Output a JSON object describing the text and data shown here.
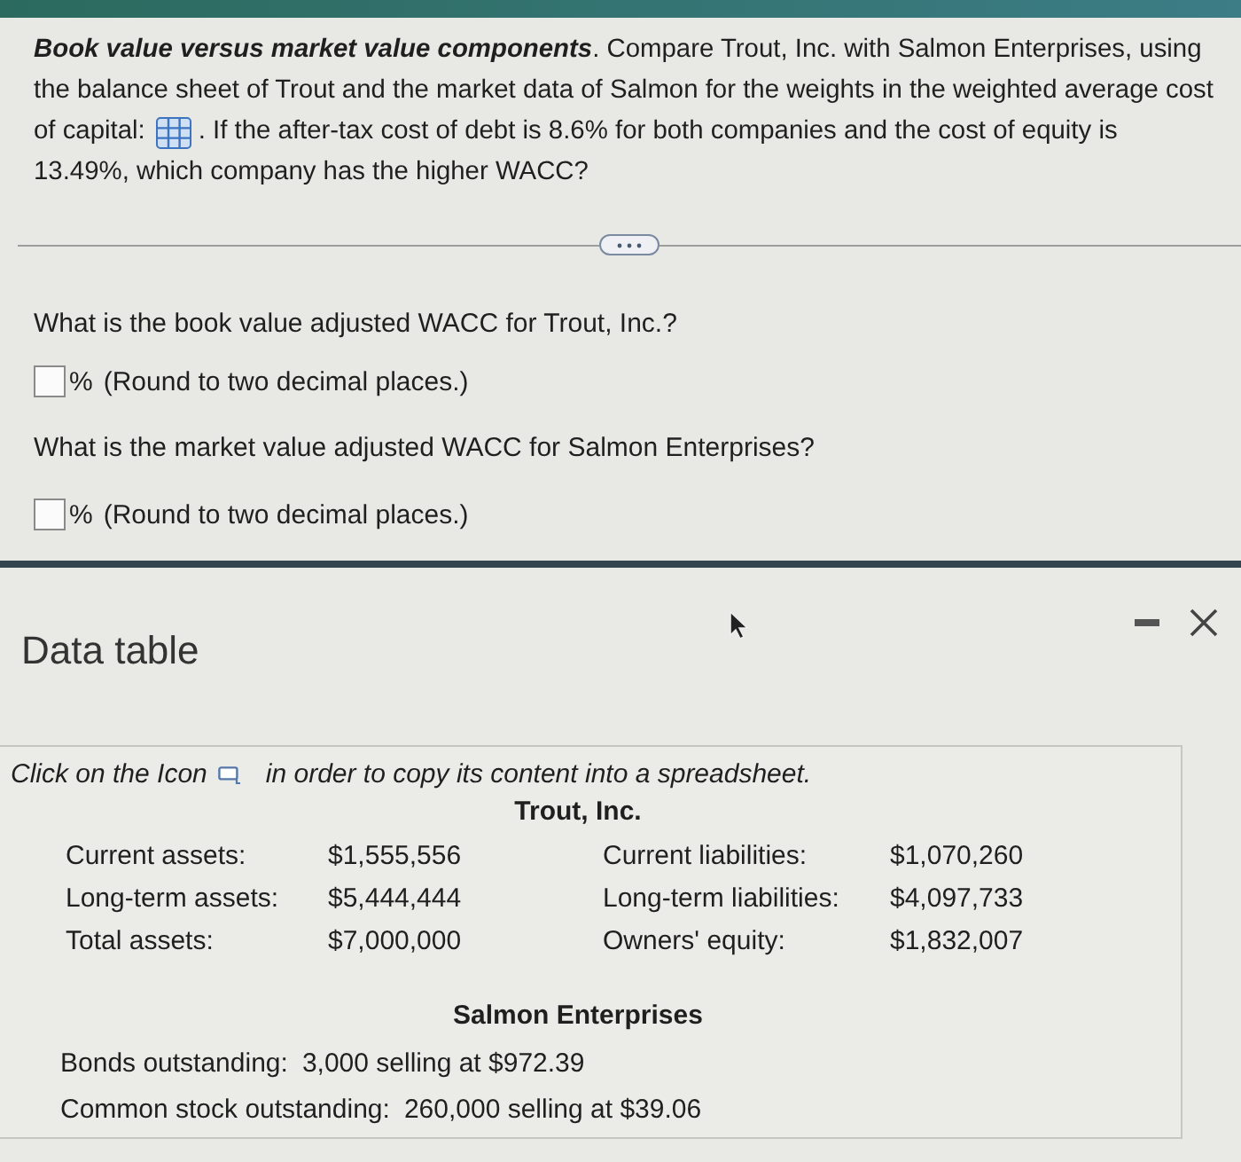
{
  "problem": {
    "title": "Book value versus market value components",
    "text_before_icon": ". Compare Trout, Inc. with Salmon Enterprises, using the balance sheet of Trout and the market data of Salmon for the weights in the weighted average cost",
    "text_beside_icon": "of capital:",
    "text_after_icon": ". If the after-tax cost of debt is 8.6% for both companies and the cost of equity is",
    "text_end": "13.49%, which company has the higher WACC?"
  },
  "questions": [
    {
      "prompt": "What is the book value adjusted WACC for Trout, Inc.?",
      "unit": "%",
      "hint": "(Round to two decimal places.)"
    },
    {
      "prompt": "What is the market value adjusted WACC for Salmon Enterprises?",
      "unit": "%",
      "hint": "(Round to two decimal places.)"
    }
  ],
  "data_table": {
    "title": "Data table",
    "instruction_before_icon": "Click on the Icon",
    "instruction_after_icon": "in order to copy its content into a spreadsheet.",
    "trout": {
      "name": "Trout, Inc.",
      "rows": [
        {
          "asset_label": "Current assets:",
          "asset_value": "$1,555,556",
          "liability_label": "Current liabilities:",
          "liability_value": "$1,070,260"
        },
        {
          "asset_label": "Long-term assets:",
          "asset_value": "$5,444,444",
          "liability_label": "Long-term liabilities:",
          "liability_value": "$4,097,733"
        },
        {
          "asset_label": "Total assets:",
          "asset_value": "$7,000,000",
          "liability_label": "Owners' equity:",
          "liability_value": "$1,832,007"
        }
      ]
    },
    "salmon": {
      "name": "Salmon Enterprises",
      "lines": [
        {
          "label": "Bonds outstanding:",
          "value": "3,000 selling at $972.39"
        },
        {
          "label": "Common stock outstanding:",
          "value": "260,000 selling at $39.06"
        }
      ]
    }
  }
}
